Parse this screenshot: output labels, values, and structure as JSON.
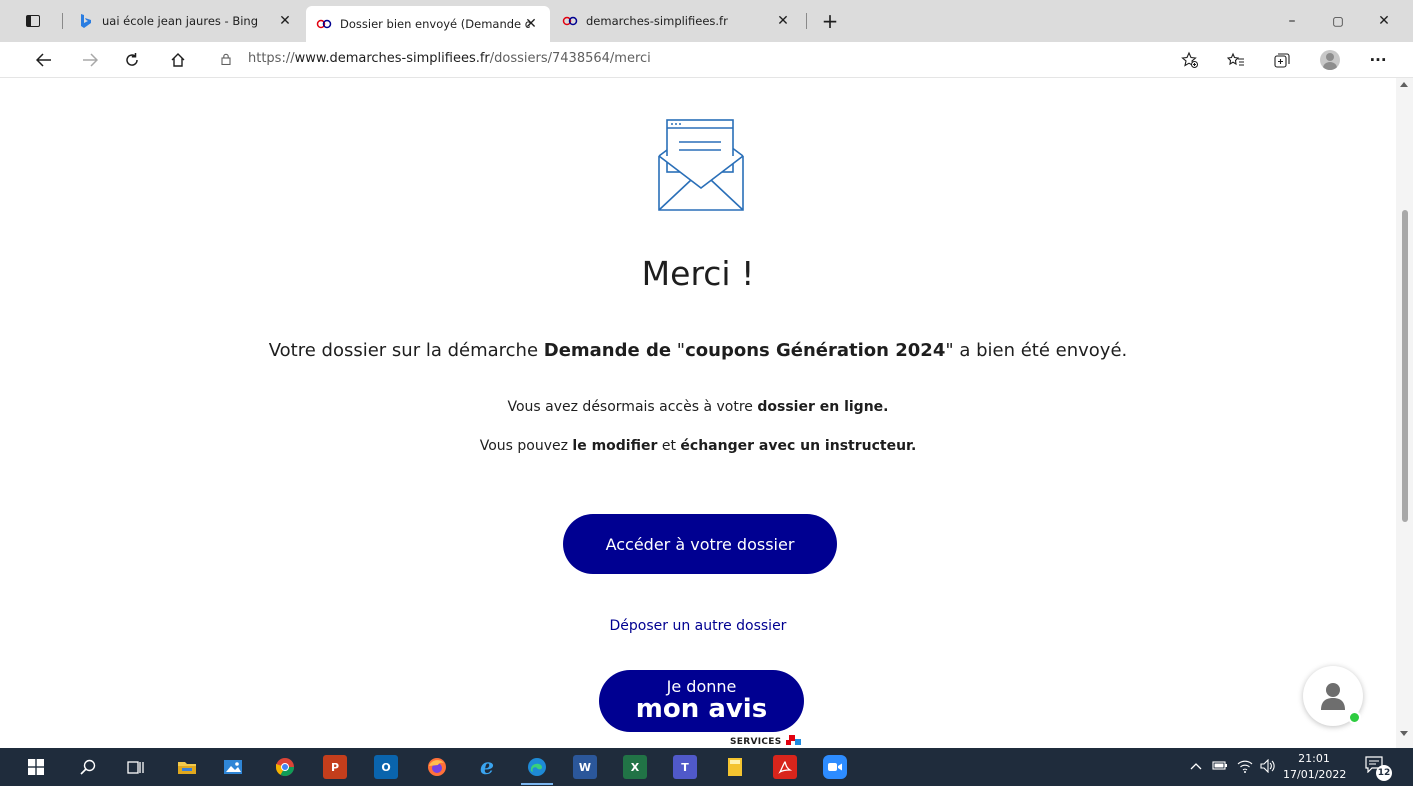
{
  "browser": {
    "tabs": [
      {
        "title": "uai école jean jaures - Bing",
        "favicon": "bing-icon",
        "active": false
      },
      {
        "title": "Dossier bien envoyé (Demande d",
        "favicon": "demarches-icon",
        "active": true
      },
      {
        "title": "demarches-simplifiees.fr",
        "favicon": "demarches-icon",
        "active": false
      }
    ],
    "close_glyph": "✕",
    "new_tab_glyph": "+",
    "url_scheme": "https://",
    "url_host": "www.demarches-simplifiees.fr",
    "url_path": "/dossiers/7438564/merci",
    "window_controls": {
      "minimize": "–",
      "restore": "▢",
      "close": "✕"
    },
    "more_glyph": "···"
  },
  "page": {
    "heading": "Merci !",
    "lead_prefix": "Votre dossier sur la démarche ",
    "lead_bold": "Demande de",
    "lead_quote": " \"",
    "lead_bold2": "coupons Génération 2024",
    "lead_suffix": "\" a bien été envoyé.",
    "line1_prefix": "Vous avez désormais accès à votre ",
    "line1_bold": "dossier en ligne.",
    "line2_prefix": "Vous pouvez ",
    "line2_bold1": "le modifier",
    "line2_mid": " et ",
    "line2_bold2": "échanger avec un instructeur.",
    "primary_button": "Accéder à votre dossier",
    "secondary_link": "Déposer un autre dossier",
    "avis_small": "Je donne",
    "avis_big": "mon avis",
    "services_label": "SERVICES",
    "brand_color": "#000091"
  },
  "taskbar": {
    "time": "21:01",
    "date": "17/01/2022",
    "notifications": "12",
    "apps": [
      "start-icon",
      "search-icon",
      "task-view-icon",
      "file-explorer-icon",
      "photos-icon",
      "chrome-icon",
      "powerpoint-icon",
      "outlook-icon",
      "firefox-icon",
      "internet-explorer-icon",
      "edge-icon",
      "word-icon",
      "excel-icon",
      "teams-icon",
      "notes-icon",
      "acrobat-icon",
      "zoom-icon"
    ]
  }
}
